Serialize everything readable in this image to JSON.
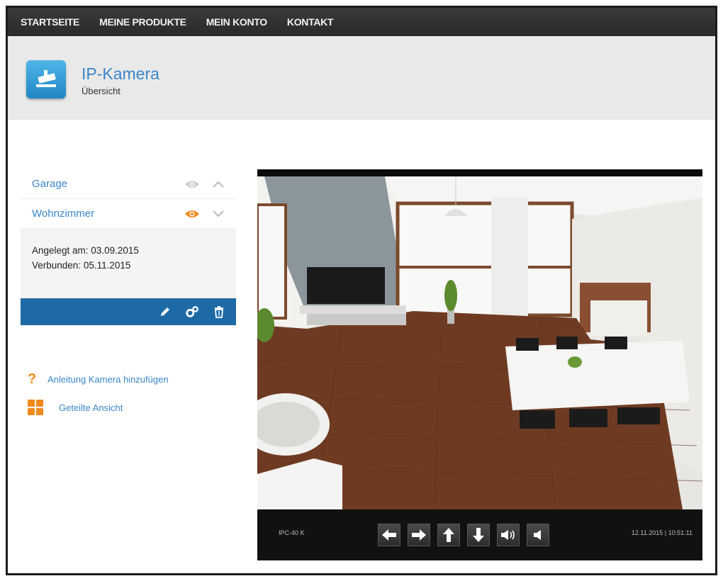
{
  "nav": {
    "items": [
      "STARTSEITE",
      "MEINE PRODUKTE",
      "MEIN KONTO",
      "KONTAKT"
    ]
  },
  "header": {
    "title": "IP-Kamera",
    "subtitle": "Übersicht",
    "icon": "camera-icon",
    "accent": "#3a86c8"
  },
  "cameras": [
    {
      "name": "Garage",
      "visibility_icon": "eye-icon",
      "visible": false,
      "expand_icon": "chevron-up-icon"
    },
    {
      "name": "Wohnzimmer",
      "visibility_icon": "eye-icon",
      "visible": true,
      "expand_icon": "chevron-down-icon"
    }
  ],
  "details": {
    "created": "Angelegt am: 03.09.2015",
    "connected": "Verbunden: 05.11.2015"
  },
  "actions": [
    "edit-pencil-icon",
    "settings-gears-icon",
    "delete-trash-icon"
  ],
  "links": [
    {
      "label": "Anleitung Kamera hinzufügen",
      "icon": "help-question-icon"
    },
    {
      "label": "Geteilte Ansicht",
      "icon": "split-view-grid-icon"
    }
  ],
  "viewer": {
    "camera_id": "IPC-40 K",
    "timestamp": "12.11.2015 | 10:51:11",
    "controls": [
      "arrow-left-icon",
      "arrow-right-icon",
      "arrow-up-icon",
      "arrow-down-icon",
      "audio-on-icon",
      "audio-off-icon"
    ]
  },
  "colors": {
    "nav_bg": "#2f2f2f",
    "header_bg": "#e9e9e9",
    "action_bar": "#1e6aa6",
    "orange": "#f08a1c"
  }
}
